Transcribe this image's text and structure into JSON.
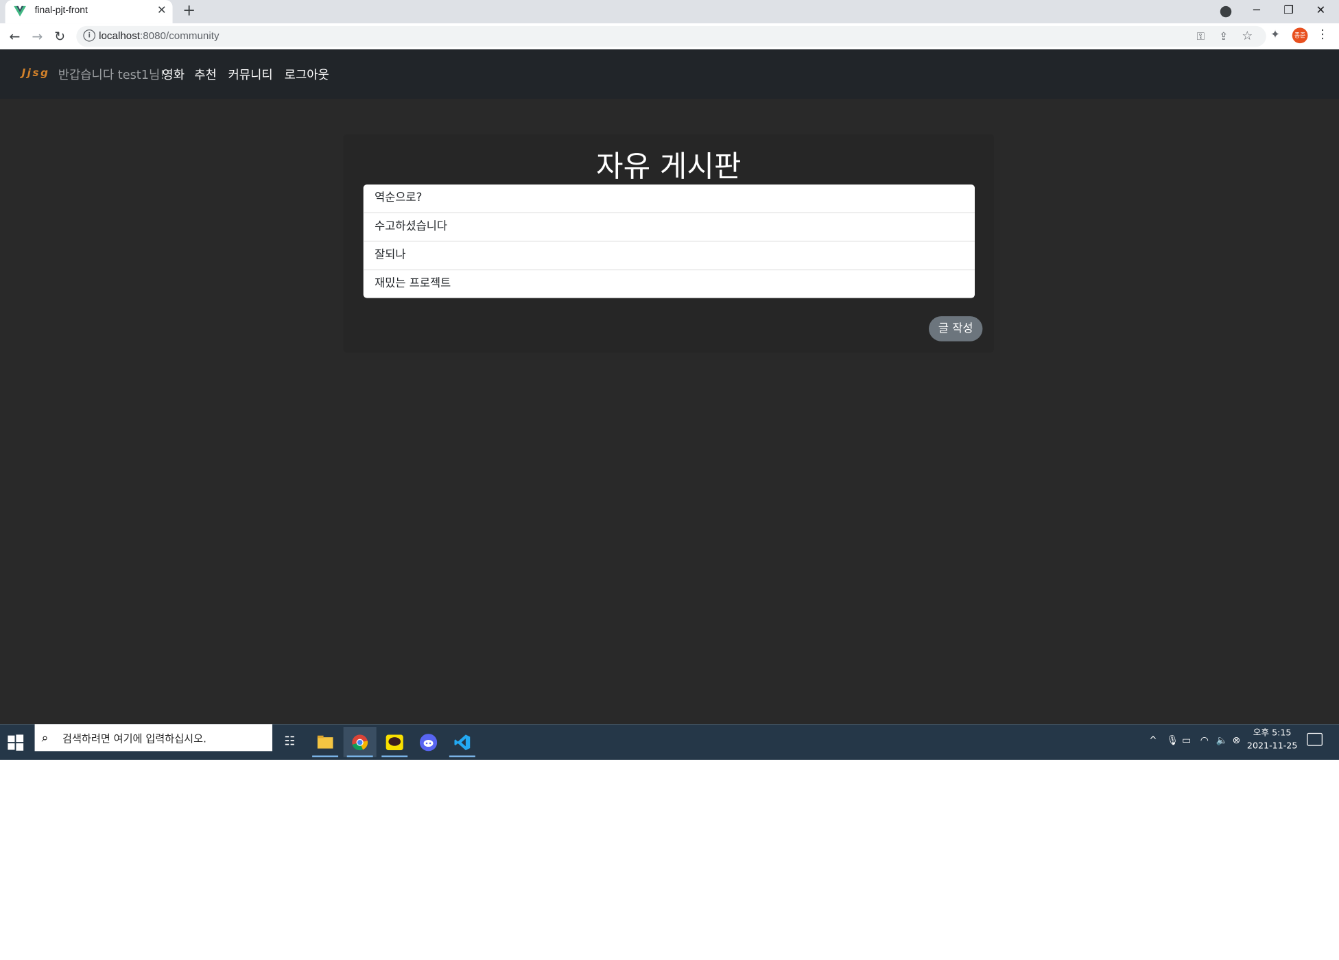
{
  "browser": {
    "tab_title": "final-pjt-front",
    "url_host": "localhost",
    "url_path": ":8080/community",
    "avatar_text": "종준"
  },
  "navbar": {
    "brand": "Jjsg",
    "greeting": "반갑습니다 test1님!",
    "links": [
      "영화",
      "추천",
      "커뮤니티",
      "로그아웃"
    ]
  },
  "board": {
    "title": "자유 게시판",
    "posts": [
      "역순으로?",
      "수고하셨습니다",
      "잘되나",
      "재밌는 프로젝트"
    ],
    "write_button": "글 작성"
  },
  "taskbar": {
    "search_placeholder": "검색하려면 여기에 입력하십시오.",
    "time": "오후 5:15",
    "date": "2021-11-25"
  },
  "colors": {
    "brand": "#d4822a",
    "navbar_bg": "#212529",
    "page_bg": "#292929",
    "button_bg": "#6c757d",
    "taskbar_bg": "#253748"
  }
}
